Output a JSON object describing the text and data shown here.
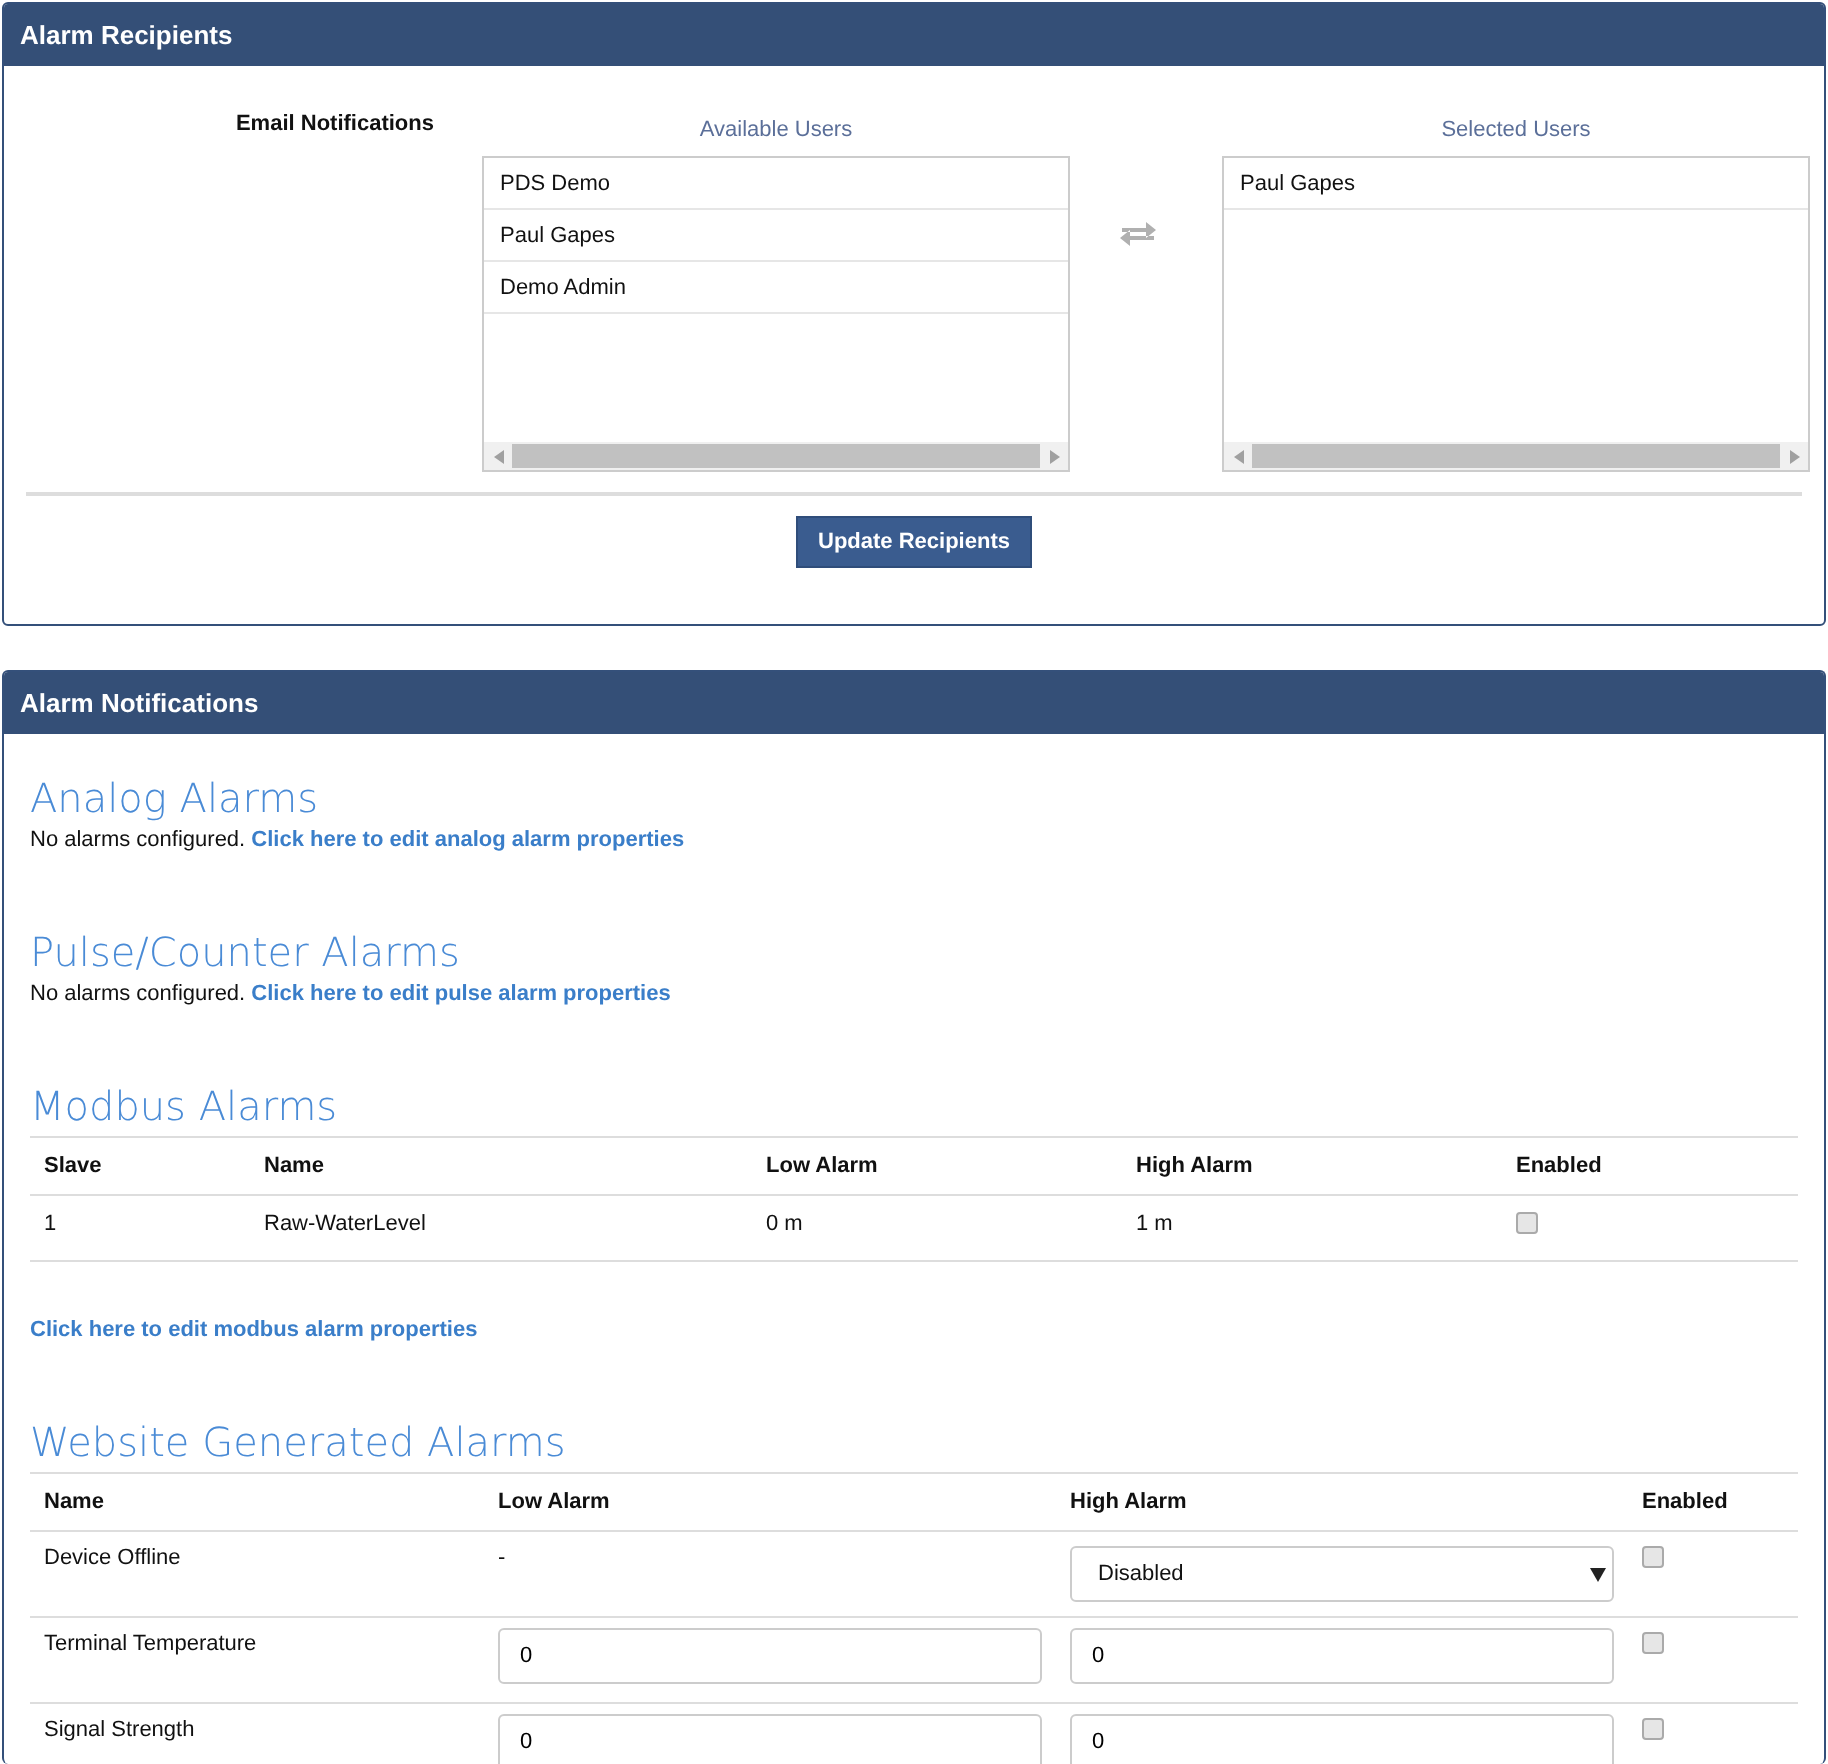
{
  "recipients": {
    "title": "Alarm Recipients",
    "label": "Email Notifications",
    "available": {
      "heading": "Available Users",
      "items": [
        "PDS Demo",
        "Paul Gapes",
        "Demo Admin"
      ]
    },
    "selected": {
      "heading": "Selected Users",
      "items": [
        "Paul Gapes"
      ]
    },
    "button": "Update Recipients"
  },
  "notifications": {
    "title": "Alarm Notifications",
    "analog": {
      "heading": "Analog Alarms",
      "text": "No alarms configured.",
      "link": "Click here to edit analog alarm properties"
    },
    "pulse": {
      "heading": "Pulse/Counter Alarms",
      "text": "No alarms configured.",
      "link": "Click here to edit pulse alarm properties"
    },
    "modbus": {
      "heading": "Modbus Alarms",
      "columns": [
        "Slave",
        "Name",
        "Low Alarm",
        "High Alarm",
        "Enabled"
      ],
      "rows": [
        {
          "slave": "1",
          "name": "Raw-WaterLevel",
          "low": "0 m",
          "high": "1 m",
          "enabled": false
        }
      ],
      "link": "Click here to edit modbus alarm properties"
    },
    "website": {
      "heading": "Website Generated Alarms",
      "columns": [
        "Name",
        "Low Alarm",
        "High Alarm",
        "Enabled"
      ],
      "rows": [
        {
          "kind": "select",
          "name": "Device Offline",
          "low": "-",
          "high": "Disabled",
          "enabled": false
        },
        {
          "kind": "inputs",
          "name": "Terminal Temperature",
          "low": "0",
          "high": "0",
          "enabled": false
        },
        {
          "kind": "inputs",
          "name": "Signal Strength",
          "low": "0",
          "high": "0",
          "enabled": false
        }
      ]
    }
  }
}
